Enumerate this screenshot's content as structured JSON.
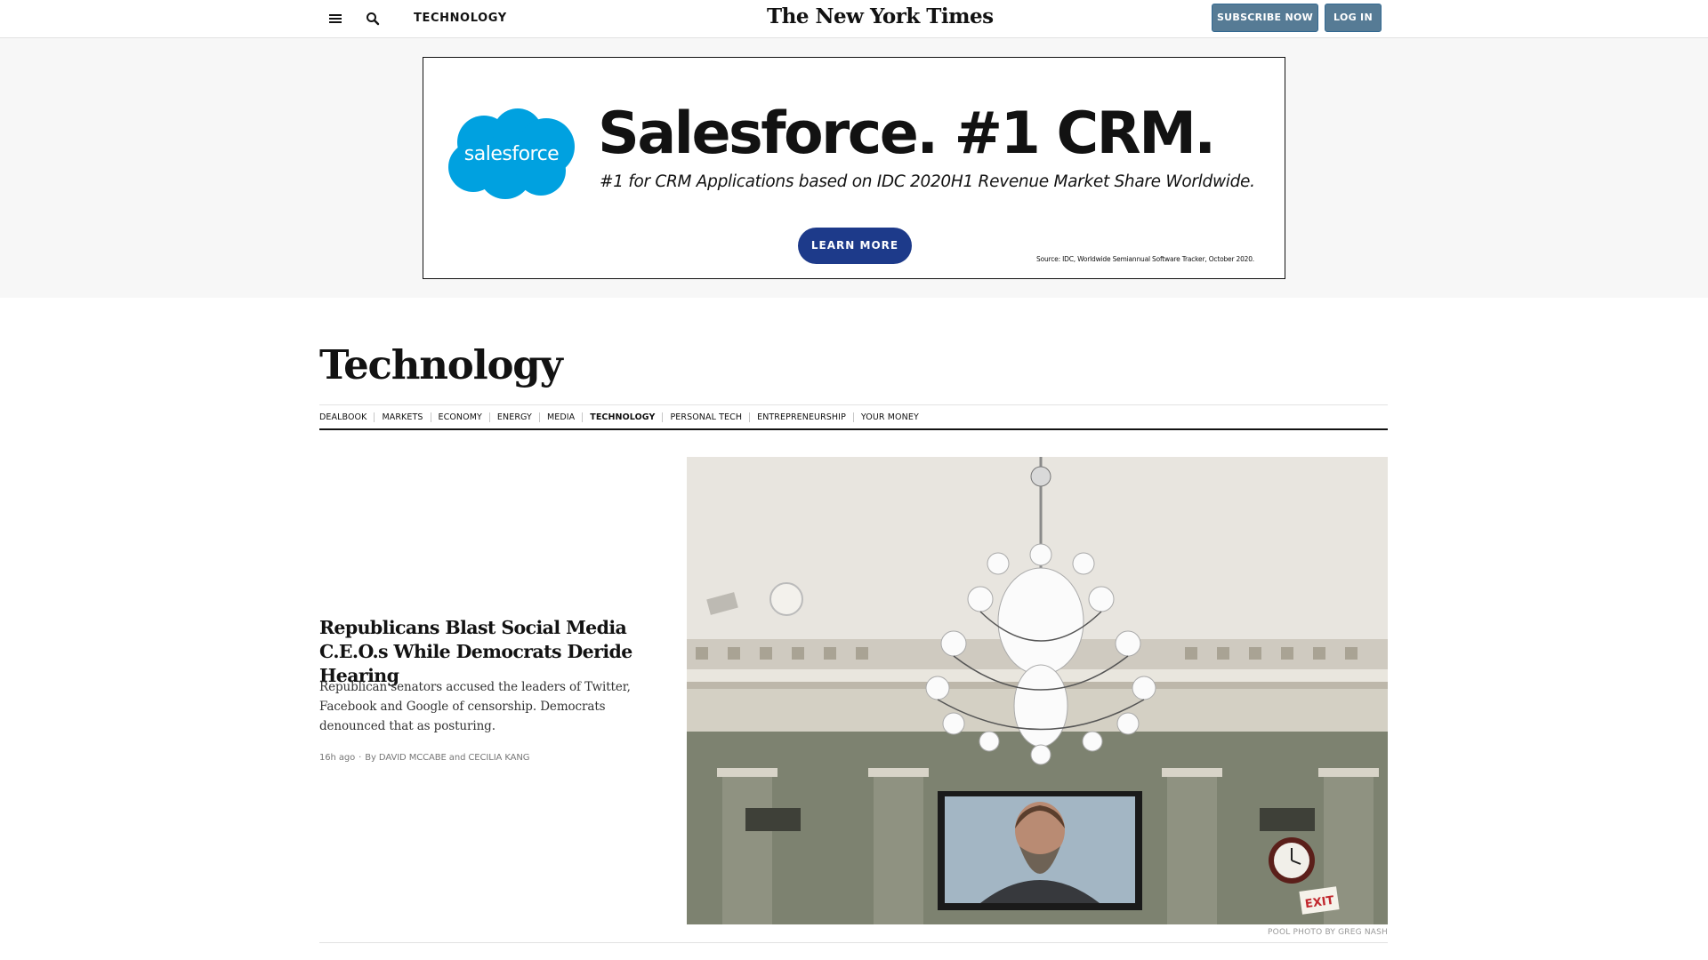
{
  "masthead": {
    "section_label": "TECHNOLOGY",
    "logo_text": "The New York Times",
    "subscribe_label": "SUBSCRIBE NOW",
    "login_label": "LOG IN",
    "menu_icon": "hamburger-menu-icon",
    "search_icon": "search-icon"
  },
  "ad": {
    "brand": "salesforce",
    "headline": "Salesforce. #1 CRM.",
    "subheadline": "#1 for CRM Applications based on IDC 2020H1 Revenue Market Share Worldwide.",
    "cta_label": "LEARN MORE",
    "source_note": "Source: IDC, Worldwide Semiannual Software Tracker, October 2020.",
    "brand_color": "#00A1E0",
    "cta_color": "#1D3A8A"
  },
  "section": {
    "title": "Technology",
    "subnav": [
      {
        "label": "DEALBOOK",
        "active": false
      },
      {
        "label": "MARKETS",
        "active": false
      },
      {
        "label": "ECONOMY",
        "active": false
      },
      {
        "label": "ENERGY",
        "active": false
      },
      {
        "label": "MEDIA",
        "active": false
      },
      {
        "label": "TECHNOLOGY",
        "active": true
      },
      {
        "label": "PERSONAL TECH",
        "active": false
      },
      {
        "label": "ENTREPRENEURSHIP",
        "active": false
      },
      {
        "label": "YOUR MONEY",
        "active": false
      }
    ]
  },
  "lead_story": {
    "headline": "Republicans Blast Social Media C.E.O.s While Democrats Deride Hearing",
    "summary": "Republican senators accused the leaders of Twitter, Facebook and Google of censorship. Democrats denounced that as posturing.",
    "time_ago": "16h ago",
    "byline_prefix": "By",
    "authors": "DAVID MCCABE and CECILIA KANG",
    "photo_credit": "POOL PHOTO BY GREG NASH",
    "photo_exit_sign": "EXIT"
  }
}
